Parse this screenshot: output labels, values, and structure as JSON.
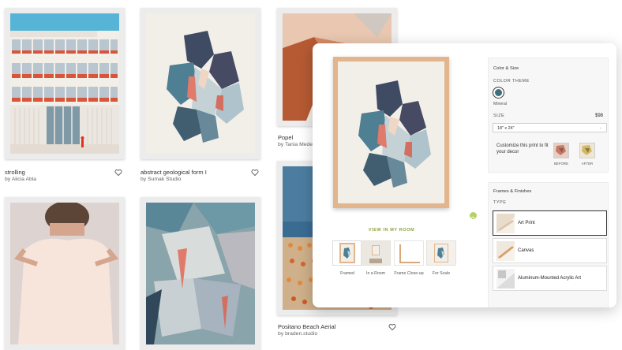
{
  "cards": [
    {
      "title": "strolling",
      "artist": "by Alicia Abla"
    },
    {
      "title": "abstract geological form I",
      "artist": "by Sumak Studio"
    },
    {
      "title": "Popel",
      "artist": "by Tania Medei"
    },
    {
      "title": "Positano Beach Aerial",
      "artist": "by braden.studio"
    }
  ],
  "viewer": {
    "view_in_room": "VIEW IN MY ROOM",
    "thumbs": [
      "Framed",
      "In a Room",
      "Frame Close-up",
      "For Scale"
    ]
  },
  "options": {
    "color_size_heading": "Color & Size",
    "color_theme_label": "COLOR THEME",
    "color_name": "Mineral",
    "color_hex": "#3f6f7d",
    "size_label": "SIZE",
    "price": "$98",
    "size_value": "18\" x 24\"",
    "customize_text": "Customize this print to fit your decor",
    "before_label": "BEFORE",
    "after_label": "AFTER",
    "frames_heading": "Frames & Finishes",
    "type_label": "TYPE",
    "types": [
      "Art Print",
      "Canvas",
      "Aluminum-Mounted Acrylic Art"
    ]
  },
  "icons": {
    "heart": "heart-icon",
    "zoom": "zoom-icon",
    "chevron": "chevron-down-icon"
  }
}
